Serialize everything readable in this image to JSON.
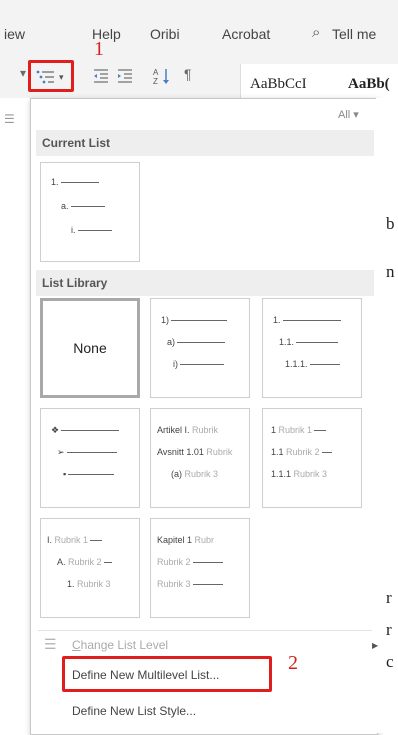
{
  "menubar": {
    "items": [
      "iew",
      "Help",
      "Oribi",
      "Acrobat"
    ],
    "tell_me": "Tell me"
  },
  "toolbar": {
    "icons": [
      "multilevel-list-icon",
      "decrease-indent-icon",
      "increase-indent-icon",
      "sort-icon",
      "pilcrow-icon"
    ],
    "style_samples": [
      "AaBbCcI",
      "AaBb("
    ]
  },
  "annotations": {
    "step1": "1",
    "step2": "2"
  },
  "panel": {
    "all_filter": "All ▾",
    "current_list_header": "Current List",
    "current_list": [
      "1.",
      "a.",
      "i."
    ],
    "library_header": "List Library",
    "library": [
      {
        "kind": "none",
        "label": "None"
      },
      {
        "kind": "list",
        "lines": [
          "1)",
          "a)",
          "i)"
        ]
      },
      {
        "kind": "list",
        "lines": [
          "1.",
          "1.1.",
          "1.1.1."
        ]
      },
      {
        "kind": "list",
        "lines": [
          "❖",
          "➢",
          "▪"
        ]
      },
      {
        "kind": "list",
        "lines": [
          "Artikel I.",
          "Avsnitt 1.01",
          "(a)"
        ],
        "captions": [
          "Rubrik",
          "Rubrik",
          "Rubrik 3"
        ]
      },
      {
        "kind": "list",
        "lines": [
          "1",
          "1.1",
          "1.1.1"
        ],
        "captions": [
          "Rubrik 1",
          "Rubrik 2",
          "Rubrik 3"
        ]
      },
      {
        "kind": "list",
        "lines": [
          "I.",
          "A.",
          "1."
        ],
        "captions": [
          "Rubrik 1",
          "Rubrik 2",
          "Rubrik 3"
        ]
      },
      {
        "kind": "list",
        "lines": [
          "Kapitel 1",
          "",
          ""
        ],
        "captions": [
          "Rubr",
          "Rubrik 2",
          "Rubrik 3"
        ]
      }
    ],
    "commands": {
      "change_level": "Change List Level",
      "define_multilevel": "Define New Multilevel List...",
      "define_style": "Define New List Style..."
    }
  },
  "doc_side": [
    "b",
    "n",
    "r",
    "r",
    "c"
  ]
}
